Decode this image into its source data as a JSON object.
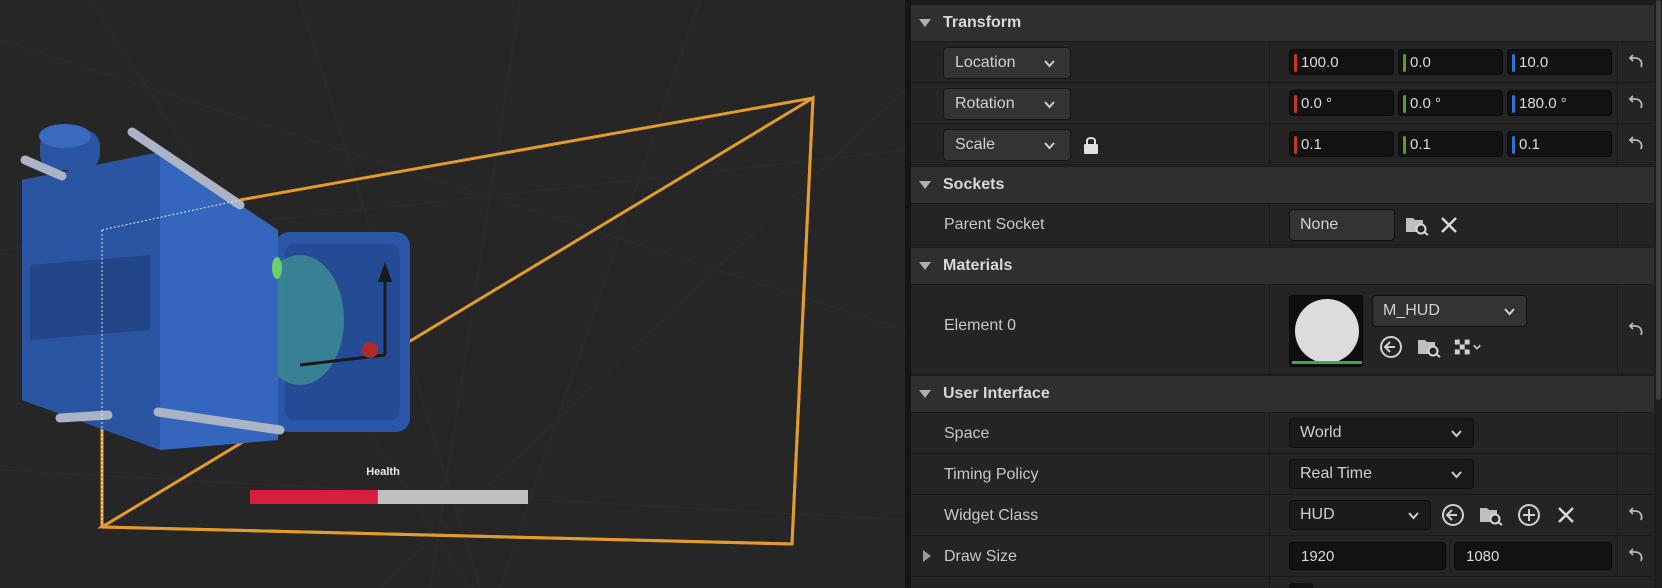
{
  "viewport": {
    "widget_label": "Health",
    "health_fraction": 0.46,
    "colors": {
      "frame": "#e39b2c",
      "health_fill": "#d81e3e",
      "health_empty": "#bfbfbf",
      "mesh": "#2b57a8"
    }
  },
  "details": {
    "transform": {
      "title": "Transform",
      "location": {
        "label": "Location",
        "x": "100.0",
        "y": "0.0",
        "z": "10.0"
      },
      "rotation": {
        "label": "Rotation",
        "x": "0.0 °",
        "y": "0.0 °",
        "z": "180.0 °"
      },
      "scale": {
        "label": "Scale",
        "x": "0.1",
        "y": "0.1",
        "z": "0.1"
      }
    },
    "sockets": {
      "title": "Sockets",
      "parent_socket": {
        "label": "Parent Socket",
        "value": "None"
      }
    },
    "materials": {
      "title": "Materials",
      "element0": {
        "label": "Element 0",
        "value": "M_HUD"
      }
    },
    "user_interface": {
      "title": "User Interface",
      "space": {
        "label": "Space",
        "value": "World"
      },
      "timing_policy": {
        "label": "Timing Policy",
        "value": "Real Time"
      },
      "widget_class": {
        "label": "Widget Class",
        "value": "HUD"
      },
      "draw_size": {
        "label": "Draw Size",
        "x": "1920",
        "y": "1080"
      }
    }
  }
}
